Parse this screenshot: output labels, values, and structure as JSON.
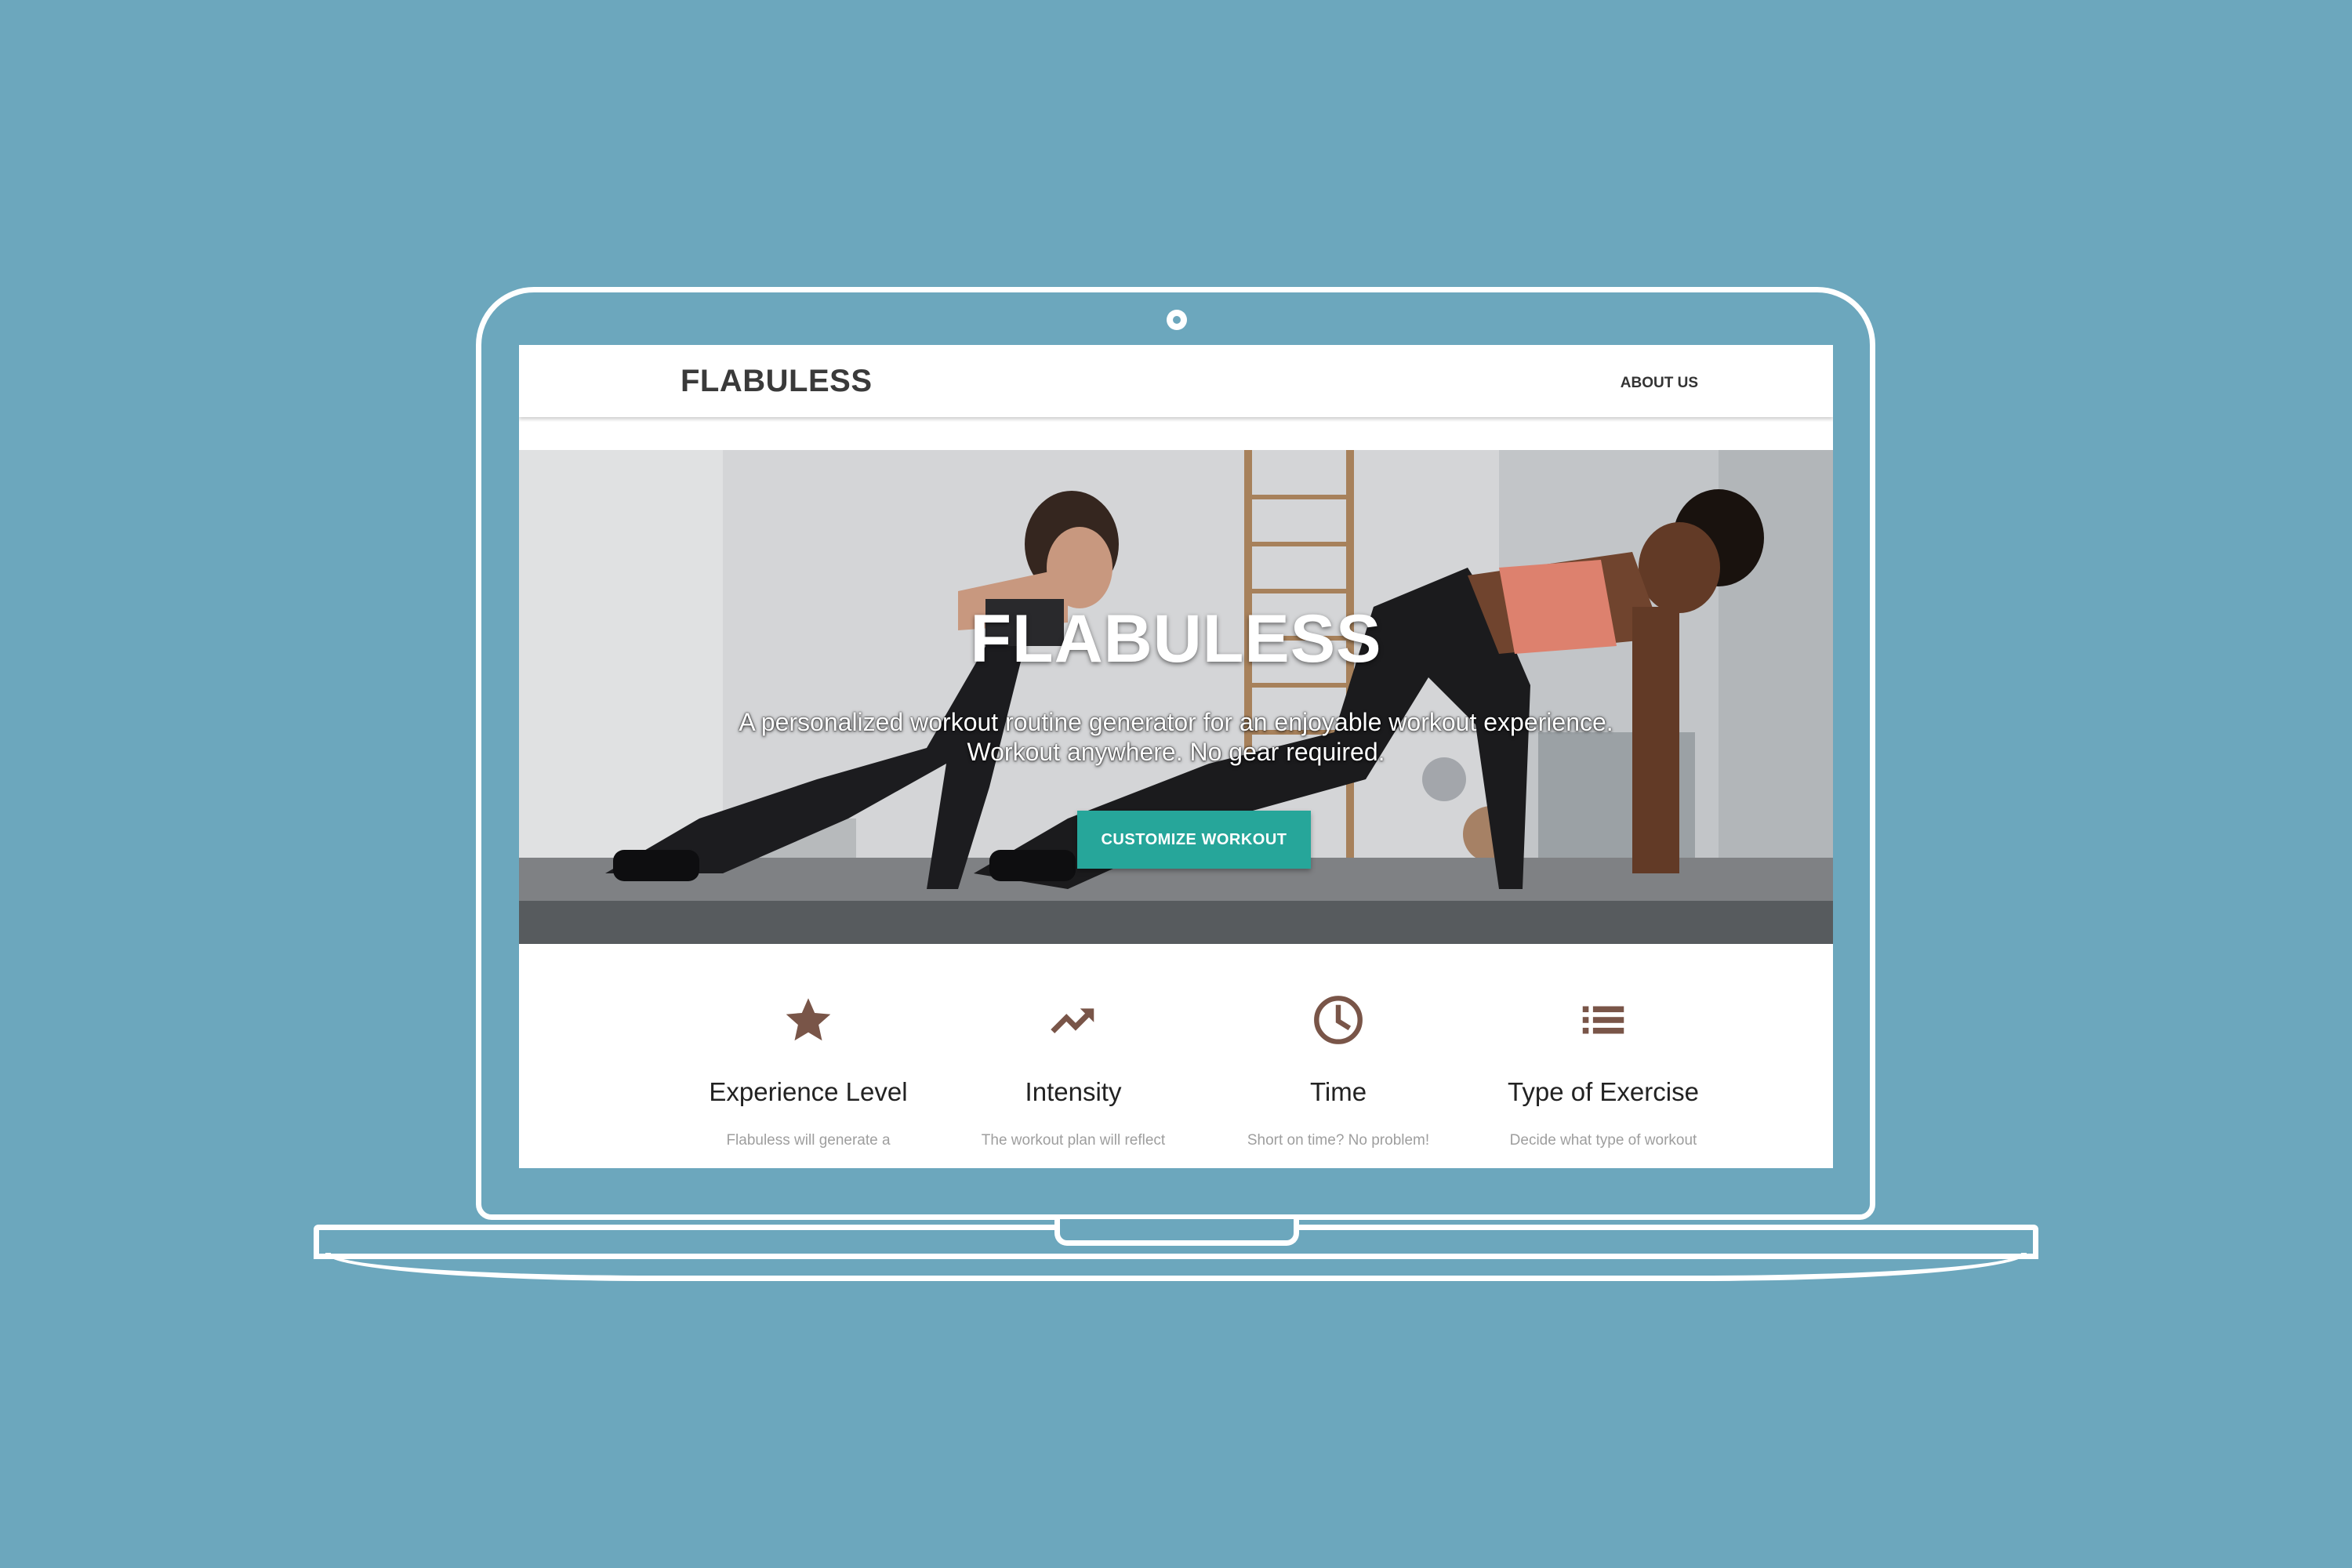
{
  "navbar": {
    "brand": "FLABULESS",
    "links": [
      {
        "label": "ABOUT US"
      }
    ]
  },
  "hero": {
    "title": "FLABULESS",
    "subtitle_line1": "A personalized workout routine generator for an enjoyable workout experience.",
    "subtitle_line2": "Workout anywhere. No gear required.",
    "cta_label": "CUSTOMIZE WORKOUT"
  },
  "features": [
    {
      "icon": "star-icon",
      "title": "Experience Level",
      "description": "Flabuless will generate a"
    },
    {
      "icon": "trending-up-icon",
      "title": "Intensity",
      "description": "The workout plan will reflect"
    },
    {
      "icon": "clock-icon",
      "title": "Time",
      "description": "Short on time? No problem!"
    },
    {
      "icon": "list-icon",
      "title": "Type of Exercise",
      "description": "Decide what type of workout"
    }
  ],
  "colors": {
    "background": "#6ca7bd",
    "accent": "#26a69a",
    "icon": "#795548",
    "brand_text": "#3a3a3a"
  }
}
